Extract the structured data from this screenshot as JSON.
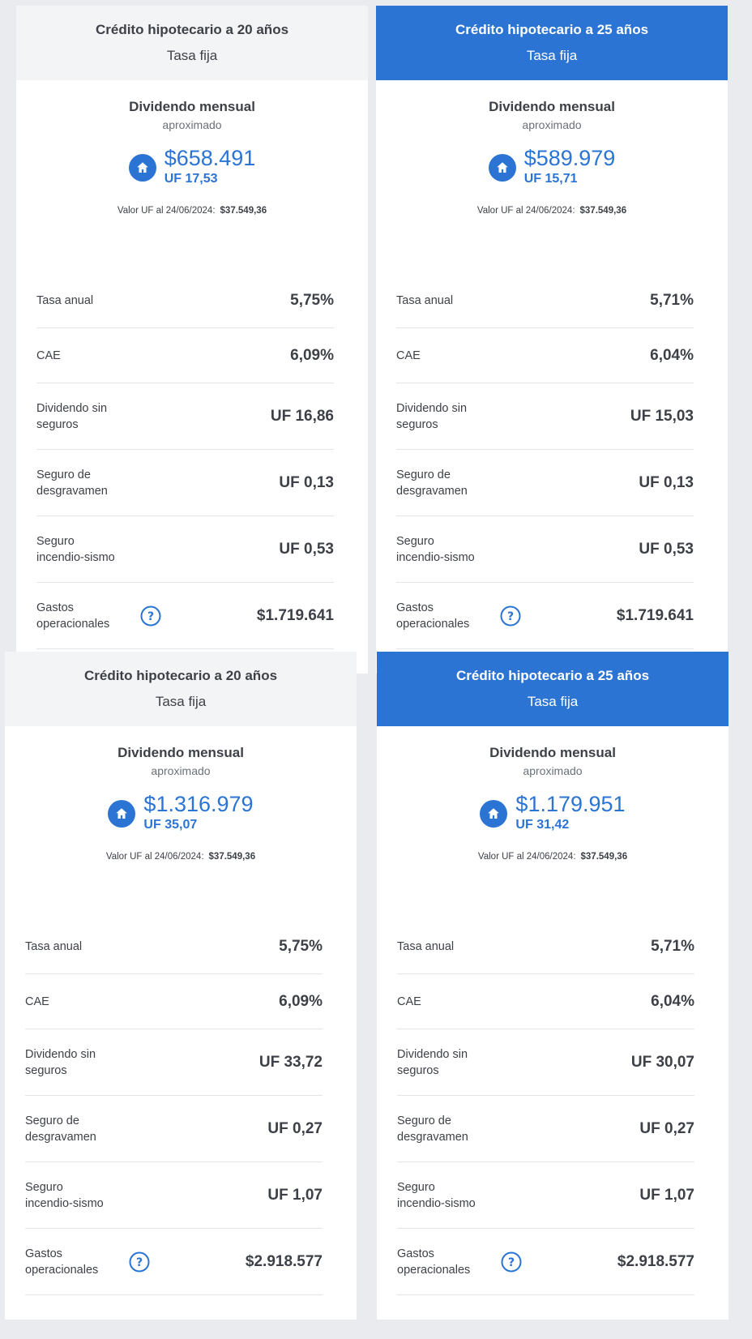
{
  "cards": [
    {
      "title": "Crédito hipotecario a 20 años",
      "subtitle": "Tasa fija",
      "dividend_label": "Dividendo mensual",
      "dividend_sub": "aproximado",
      "amount": "$658.491",
      "amount_uf": "UF 17,53",
      "uf_note_label": "Valor UF al 24/06/2024:",
      "uf_note_value": "$37.549,36",
      "rows": [
        {
          "label": "Tasa anual",
          "value": "5,75%"
        },
        {
          "label": "CAE",
          "value": "6,09%"
        },
        {
          "label": "Dividendo sin\nseguros",
          "value": "UF 16,86"
        },
        {
          "label": "Seguro de\ndesgravamen",
          "value": "UF 0,13"
        },
        {
          "label": "Seguro\nincendio-sismo",
          "value": "UF 0,53"
        },
        {
          "label": "Gastos\noperacionales",
          "value": "$1.719.641"
        }
      ]
    },
    {
      "title": "Crédito hipotecario a 25 años",
      "subtitle": "Tasa fija",
      "dividend_label": "Dividendo mensual",
      "dividend_sub": "aproximado",
      "amount": "$589.979",
      "amount_uf": "UF 15,71",
      "uf_note_label": "Valor UF al 24/06/2024:",
      "uf_note_value": "$37.549,36",
      "rows": [
        {
          "label": "Tasa anual",
          "value": "5,71%"
        },
        {
          "label": "CAE",
          "value": "6,04%"
        },
        {
          "label": "Dividendo sin\nseguros",
          "value": "UF 15,03"
        },
        {
          "label": "Seguro de\ndesgravamen",
          "value": "UF 0,13"
        },
        {
          "label": "Seguro\nincendio-sismo",
          "value": "UF 0,53"
        },
        {
          "label": "Gastos\noperacionales",
          "value": "$1.719.641"
        }
      ]
    },
    {
      "title": "Crédito hipotecario a 20 años",
      "subtitle": "Tasa fija",
      "dividend_label": "Dividendo mensual",
      "dividend_sub": "aproximado",
      "amount": "$1.316.979",
      "amount_uf": "UF 35,07",
      "uf_note_label": "Valor UF al 24/06/2024:",
      "uf_note_value": "$37.549,36",
      "rows": [
        {
          "label": "Tasa anual",
          "value": "5,75%"
        },
        {
          "label": "CAE",
          "value": "6,09%"
        },
        {
          "label": "Dividendo sin\nseguros",
          "value": "UF 33,72"
        },
        {
          "label": "Seguro de\ndesgravamen",
          "value": "UF 0,27"
        },
        {
          "label": "Seguro\nincendio-sismo",
          "value": "UF 1,07"
        },
        {
          "label": "Gastos\noperacionales",
          "value": "$2.918.577"
        }
      ]
    },
    {
      "title": "Crédito hipotecario a 25 años",
      "subtitle": "Tasa fija",
      "dividend_label": "Dividendo mensual",
      "dividend_sub": "aproximado",
      "amount": "$1.179.951",
      "amount_uf": "UF 31,42",
      "uf_note_label": "Valor UF al 24/06/2024:",
      "uf_note_value": "$37.549,36",
      "rows": [
        {
          "label": "Tasa anual",
          "value": "5,71%"
        },
        {
          "label": "CAE",
          "value": "6,04%"
        },
        {
          "label": "Dividendo sin\nseguros",
          "value": "UF 30,07"
        },
        {
          "label": "Seguro de\ndesgravamen",
          "value": "UF 0,27"
        },
        {
          "label": "Seguro\nincendio-sismo",
          "value": "UF 1,07"
        },
        {
          "label": "Gastos\noperacionales",
          "value": "$2.918.577"
        }
      ]
    }
  ],
  "icons": {
    "amount": "house-icon",
    "gastos": "question-circle-icon"
  },
  "colors": {
    "accent": "#2b74d4",
    "header_neutral": "#f3f4f6",
    "text": "#3d4147"
  }
}
